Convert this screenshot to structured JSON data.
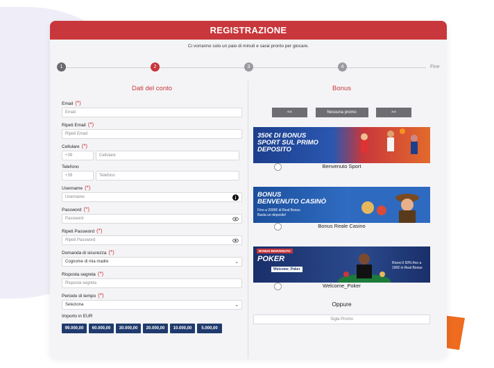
{
  "header": {
    "title": "REGISTRAZIONE"
  },
  "subtitle": "Ci vorranno solo un paio di minuti e sarai pronto per giocare.",
  "stepper": {
    "steps": [
      "1",
      "2",
      "3",
      "4"
    ],
    "end_label": "Fine",
    "active_step": 2
  },
  "left": {
    "title": "Dati del conto",
    "required_mark": "(*)",
    "email": {
      "label": "Email",
      "placeholder": "Email"
    },
    "repeat_email": {
      "label": "Ripeti Email",
      "placeholder": "Ripeti Email"
    },
    "mobile": {
      "label": "Cellulare",
      "prefix": "+39",
      "placeholder": "Cellulare"
    },
    "phone": {
      "label": "Telefono",
      "prefix": "+39",
      "placeholder": "Telefono"
    },
    "username": {
      "label": "Username",
      "placeholder": "Username"
    },
    "password": {
      "label": "Password",
      "placeholder": "Password"
    },
    "repeat_password": {
      "label": "Ripeti Password",
      "placeholder": "Ripeti Password"
    },
    "security_question": {
      "label": "Domanda di sicurezza",
      "value": "Cognome di mia madre"
    },
    "secret_answer": {
      "label": "Risposta segreta",
      "placeholder": "Risposta segreta"
    },
    "time_period": {
      "label": "Periodo di tempo",
      "value": "Seleziona"
    },
    "amount": {
      "label": "Importo in EUR",
      "options": [
        "99.000,00",
        "60.000,00",
        "30.000,00",
        "20.000,00",
        "10.000,00",
        "5.000,00"
      ]
    }
  },
  "right": {
    "title": "Bonus",
    "prev_label": "<<",
    "none_label": "Nessuna promo",
    "next_label": ">>",
    "banners": [
      {
        "text_line1": "350€ DI BONUS",
        "text_line2": "SPORT SUL PRIMO",
        "text_line3": "DEPOSITO",
        "option": "Benvenuto Sport"
      },
      {
        "text_line1": "BONUS",
        "text_line2": "BENVENUTO CASINÒ",
        "text_small1": "Fino a 2000€ di Real Bonus",
        "text_small2": "Basta un deposito!",
        "option": "Bonus Reale Casino"
      },
      {
        "badge": "BONUS BENVENUTO",
        "text_line1": "POKER",
        "code": "Welcome_Poker",
        "text_small1": "Ricevi il 50% fino a",
        "text_small2": "100€ in Real Bonus",
        "option": "Welcome_Poker"
      }
    ],
    "or_label": "Oppure",
    "promo_placeholder": "Sigla Promo"
  },
  "colors": {
    "brand_red": "#c8373b",
    "navy": "#1f3b6d",
    "orange": "#ee6b1f"
  }
}
